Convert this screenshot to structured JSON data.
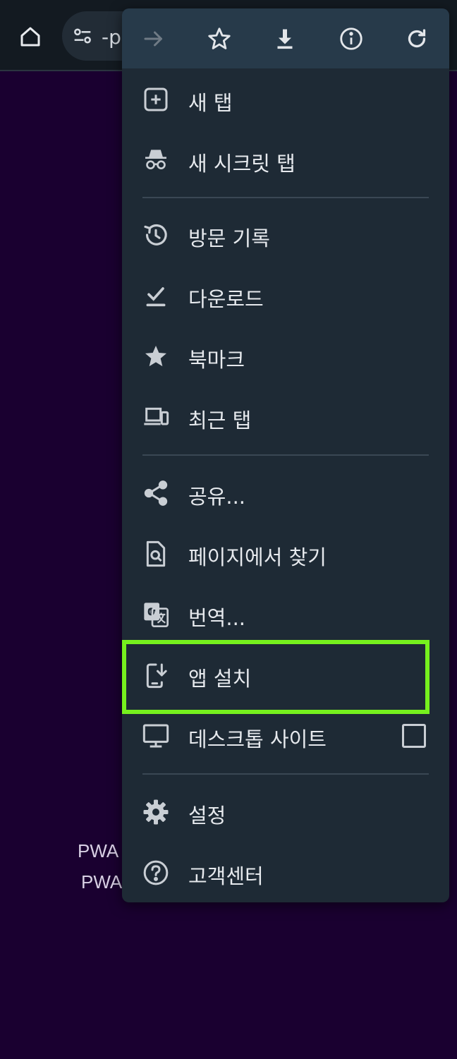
{
  "address_bar": {
    "url_fragment": "-p"
  },
  "background": {
    "line1": "PWA",
    "line2": "PWA"
  },
  "menu": {
    "items": [
      {
        "label": "새 탭",
        "icon": "new-tab-icon"
      },
      {
        "label": "새 시크릿 탭",
        "icon": "incognito-icon"
      },
      {
        "label": "방문 기록",
        "icon": "history-icon"
      },
      {
        "label": "다운로드",
        "icon": "downloads-icon"
      },
      {
        "label": "북마크",
        "icon": "bookmarks-icon"
      },
      {
        "label": "최근 탭",
        "icon": "recent-tabs-icon"
      },
      {
        "label": "공유...",
        "icon": "share-icon"
      },
      {
        "label": "페이지에서 찾기",
        "icon": "find-in-page-icon"
      },
      {
        "label": "번역...",
        "icon": "translate-icon"
      },
      {
        "label": "앱 설치",
        "icon": "install-app-icon"
      },
      {
        "label": "데스크톱 사이트",
        "icon": "desktop-icon",
        "checked": false
      },
      {
        "label": "설정",
        "icon": "settings-icon"
      },
      {
        "label": "고객센터",
        "icon": "help-icon"
      }
    ]
  },
  "colors": {
    "page_background": "#1a0030",
    "menu_background": "#1e2a35",
    "highlight": "#76f01e"
  }
}
